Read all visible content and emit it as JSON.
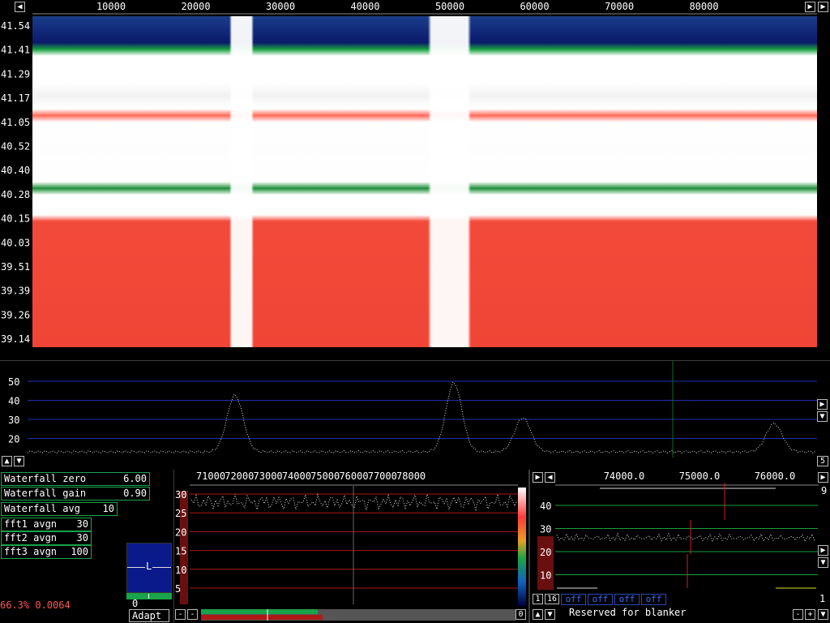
{
  "waterfall": {
    "freq_ticks": [
      "10000",
      "20000",
      "30000",
      "40000",
      "50000",
      "60000",
      "70000",
      "80000"
    ],
    "time_labels": [
      "41.54",
      "41.41",
      "41.29",
      "41.17",
      "41.05",
      "40.52",
      "40.40",
      "40.28",
      "40.15",
      "40.03",
      "39.51",
      "39.39",
      "39.26",
      "39.14"
    ]
  },
  "spectrum": {
    "y_ticks": [
      "50",
      "40",
      "30",
      "20"
    ],
    "right_value": "5"
  },
  "controls": {
    "waterfall_zero": {
      "label": "Waterfall zero",
      "value": "6.00"
    },
    "waterfall_gain": {
      "label": "Waterfall gain",
      "value": "0.90"
    },
    "waterfall_avg": {
      "label": "Waterfall avg",
      "value": "10"
    },
    "fft1_avgn": {
      "label": "fft1 avgn",
      "value": "30"
    },
    "fft2_avgn": {
      "label": "fft2 avgn",
      "value": "30"
    },
    "fft3_avgn": {
      "label": "fft3 avgn",
      "value": "100"
    }
  },
  "status": {
    "readout": "66.3% 0.0064"
  },
  "meter": {
    "channel": "L",
    "value": "0",
    "button": "Adapt"
  },
  "baseband": {
    "freq_ticks": [
      "71000",
      "72000",
      "73000",
      "74000",
      "75000",
      "76000",
      "77000",
      "78000"
    ],
    "y_ticks": [
      "30",
      "25",
      "20",
      "15",
      "10",
      "5"
    ],
    "minus1": "-",
    "minus2": "-",
    "right_value": "0"
  },
  "hires": {
    "freq_ticks": [
      "74000.0",
      "75000.0",
      "76000.0"
    ],
    "y_ticks": [
      "40",
      "30",
      "20",
      "10"
    ],
    "top_right": "9",
    "bottom_right": "1",
    "btn_1": "1",
    "btn_16": "16",
    "off_buttons": [
      "off",
      "off",
      "off",
      "off"
    ],
    "blanker_text": "Reserved for blanker",
    "minus": "-",
    "plus": "+"
  },
  "colors": {
    "grid_blue": "#1c2fb0",
    "grid_red": "#b01818",
    "grid_green": "#17a03a",
    "control_border": "#1aa34a",
    "readout": "#ff5555"
  },
  "icons": {
    "left": "arrow-left-icon",
    "right": "arrow-right-icon",
    "up": "arrow-up-icon",
    "down": "arrow-down-icon"
  }
}
